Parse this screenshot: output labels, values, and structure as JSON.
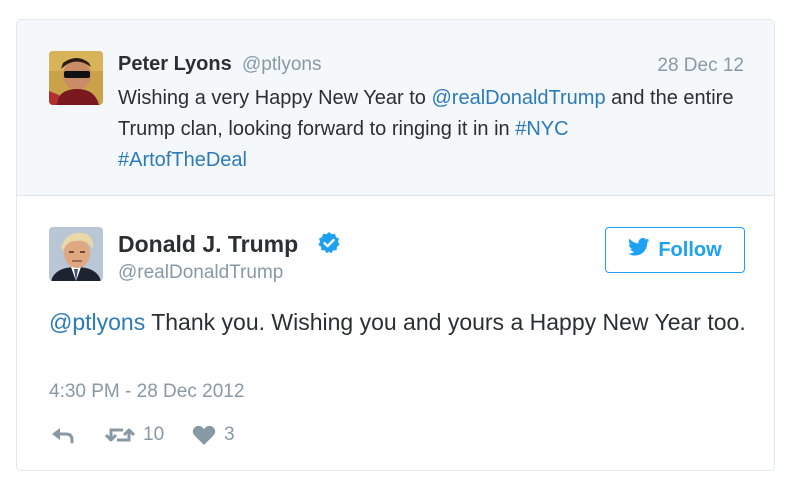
{
  "quoted_tweet": {
    "name": "Peter Lyons",
    "handle": "@ptlyons",
    "date": "28 Dec 12",
    "text_before_mention": "Wishing a very Happy New Year to ",
    "mention": "@realDonaldTrump",
    "text_after_mention": " and the entire Trump clan, looking forward to ringing it in in ",
    "hashtag1": "#NYC",
    "hashtag2": "#ArtofTheDeal"
  },
  "main_tweet": {
    "name": "Donald J. Trump",
    "handle": "@realDonaldTrump",
    "follow_label": "Follow",
    "mention": "@ptlyons",
    "text": " Thank you. Wishing you and yours a Happy New Year too.",
    "timestamp": "4:30 PM - 28 Dec 2012",
    "retweet_count": "10",
    "like_count": "3"
  },
  "colors": {
    "link": "#2b7bb9",
    "accent": "#1da1f2",
    "muted": "#8899a6",
    "quoted_bg": "#f5f8fa"
  },
  "icons": [
    "verified-badge-icon",
    "twitter-bird-icon",
    "reply-icon",
    "retweet-icon",
    "heart-icon"
  ]
}
